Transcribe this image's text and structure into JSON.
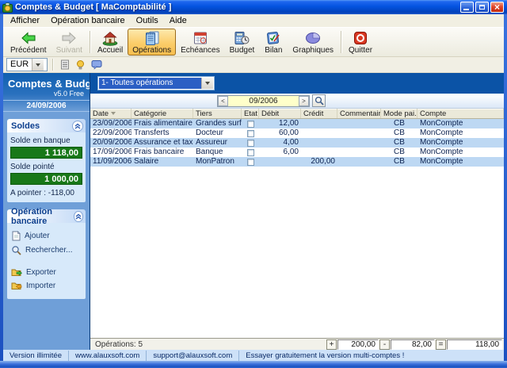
{
  "window": {
    "title": "Comptes & Budget [ MaComptabilité ]"
  },
  "menubar": {
    "items": [
      "Afficher",
      "Opération bancaire",
      "Outils",
      "Aide"
    ]
  },
  "toolbar": {
    "buttons": [
      {
        "label": "Précédent"
      },
      {
        "label": "Suivant"
      },
      {
        "label": "Accueil"
      },
      {
        "label": "Opérations"
      },
      {
        "label": "Echéances"
      },
      {
        "label": "Budget"
      },
      {
        "label": "Bilan"
      },
      {
        "label": "Graphiques"
      },
      {
        "label": "Quitter"
      }
    ]
  },
  "currency_bar": {
    "currency": "EUR"
  },
  "sidebar": {
    "app_title": "Comptes & Budget",
    "version": "v5.0 Free",
    "date": "24/09/2006",
    "soldes_panel": {
      "title": "Soldes",
      "solde_banque_label": "Solde en banque",
      "solde_banque_value": "1 118,00",
      "solde_pointe_label": "Solde pointé",
      "solde_pointe_value": "1 000,00",
      "a_pointer": "A pointer : -118,00"
    },
    "operation_panel": {
      "title": "Opération bancaire",
      "items": [
        "Ajouter",
        "Rechercher...",
        "Exporter",
        "Importer"
      ]
    }
  },
  "main": {
    "filter_dropdown": "1- Toutes opérations",
    "period": "09/2006",
    "period_nav": {
      "prev": "<",
      "next": ">"
    },
    "table": {
      "columns": [
        "Date",
        "Catégorie",
        "Tiers",
        "Etat",
        "Débit",
        "Crédit",
        "Commentaire",
        "Mode pai...",
        "Compte"
      ],
      "rows": [
        {
          "date": "23/09/2006",
          "categorie": "Frais alimentaire",
          "tiers": "Grandes surfac",
          "debit": "12,00",
          "credit": "",
          "commentaire": "",
          "mode": "CB",
          "compte": "MonCompte"
        },
        {
          "date": "22/09/2006",
          "categorie": "Transferts",
          "tiers": "Docteur",
          "debit": "60,00",
          "credit": "",
          "commentaire": "",
          "mode": "CB",
          "compte": "MonCompte"
        },
        {
          "date": "20/09/2006",
          "categorie": "Assurance et taxes .",
          "tiers": "Assureur",
          "debit": "4,00",
          "credit": "",
          "commentaire": "",
          "mode": "CB",
          "compte": "MonCompte"
        },
        {
          "date": "17/09/2006",
          "categorie": "Frais bancaire",
          "tiers": "Banque",
          "debit": "6,00",
          "credit": "",
          "commentaire": "",
          "mode": "CB",
          "compte": "MonCompte"
        },
        {
          "date": "11/09/2006",
          "categorie": "Salaire",
          "tiers": "MonPatron",
          "debit": "",
          "credit": "200,00",
          "commentaire": "",
          "mode": "CB",
          "compte": "MonCompte"
        }
      ]
    },
    "status": {
      "operations": "Opérations: 5",
      "plus": "+",
      "total_credit": "200,00",
      "minus": "-",
      "total_debit": "82,00",
      "equals": "=",
      "balance": "118,00"
    }
  },
  "statusbar": {
    "items": [
      "Version illimitée",
      "www.alauxsoft.com",
      "support@alauxsoft.com",
      "Essayer gratuitement la version multi-comptes !"
    ]
  },
  "colors": {
    "titlebar_blue": "#0453e0",
    "band_blue": "#0b53a6",
    "sidebar_blue": "#6f9fd8",
    "active_button_orange": "#fbcd69",
    "positive_green": "#187818",
    "row_alt_blue": "#bdd8f3",
    "period_field_yellow": "#ffffca"
  }
}
